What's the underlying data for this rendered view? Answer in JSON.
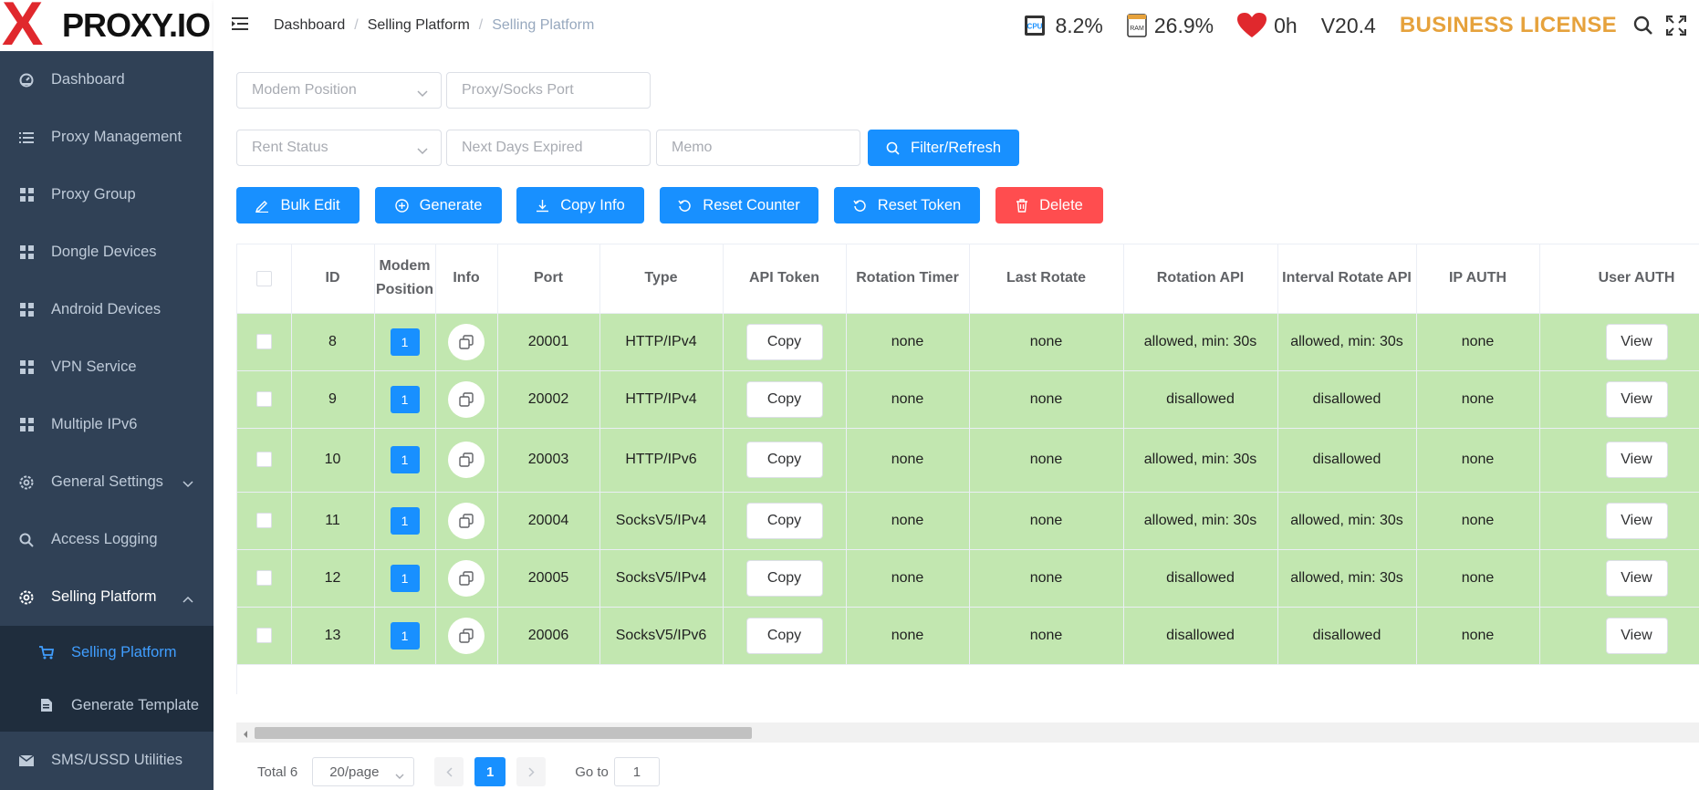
{
  "logo": {
    "x": "X",
    "text": "PROXY.IO"
  },
  "sidebar": {
    "items": [
      {
        "label": "Dashboard",
        "icon": "dashboard-icon"
      },
      {
        "label": "Proxy Management",
        "icon": "list-icon"
      },
      {
        "label": "Proxy Group",
        "icon": "grid-icon"
      },
      {
        "label": "Dongle Devices",
        "icon": "grid-icon"
      },
      {
        "label": "Android Devices",
        "icon": "grid-icon"
      },
      {
        "label": "VPN Service",
        "icon": "grid-icon"
      },
      {
        "label": "Multiple IPv6",
        "icon": "grid-icon"
      },
      {
        "label": "General Settings",
        "icon": "gear-icon"
      },
      {
        "label": "Access Logging",
        "icon": "search-icon"
      },
      {
        "label": "Selling Platform",
        "icon": "gear-icon"
      }
    ],
    "sub_items": [
      {
        "label": "Selling Platform",
        "icon": "cart-icon"
      },
      {
        "label": "Generate Template",
        "icon": "document-icon"
      }
    ],
    "bottom_item": {
      "label": "SMS/USSD Utilities",
      "icon": "mail-icon"
    }
  },
  "header": {
    "breadcrumb": [
      "Dashboard",
      "Selling Platform",
      "Selling Platform"
    ],
    "separator": "/",
    "cpu": "8.2%",
    "ram": "26.9%",
    "uptime": "0h",
    "version": "V20.4",
    "license": "BUSINESS LICENSE",
    "cpu_label": "CPU",
    "ram_label": "RAM"
  },
  "filters": {
    "modem_position": "Modem Position",
    "proxy_port": "Proxy/Socks Port",
    "rent_status": "Rent Status",
    "next_days": "Next Days Expired",
    "memo": "Memo",
    "filter_button": "Filter/Refresh"
  },
  "actions": {
    "bulk_edit": "Bulk Edit",
    "generate": "Generate",
    "copy_info": "Copy Info",
    "reset_counter": "Reset Counter",
    "reset_token": "Reset Token",
    "delete": "Delete"
  },
  "table": {
    "headers": [
      "ID",
      "Modem Position",
      "Info",
      "Port",
      "Type",
      "API Token",
      "Rotation Timer",
      "Last Rotate",
      "Rotation API",
      "Interval Rotate API",
      "IP AUTH",
      "User AUTH"
    ],
    "copy_label": "Copy",
    "view_label": "View",
    "rows": [
      {
        "id": "8",
        "modem": "1",
        "port": "20001",
        "type": "HTTP/IPv4",
        "timer": "none",
        "last": "none",
        "rot_api": "allowed, min: 30s",
        "interval_api": "allowed, min: 30s",
        "ip_auth": "none"
      },
      {
        "id": "9",
        "modem": "1",
        "port": "20002",
        "type": "HTTP/IPv4",
        "timer": "none",
        "last": "none",
        "rot_api": "disallowed",
        "interval_api": "disallowed",
        "ip_auth": "none"
      },
      {
        "id": "10",
        "modem": "1",
        "port": "20003",
        "type": "HTTP/IPv6",
        "timer": "none",
        "last": "none",
        "rot_api": "allowed, min: 30s",
        "interval_api": "disallowed",
        "ip_auth": "none"
      },
      {
        "id": "11",
        "modem": "1",
        "port": "20004",
        "type": "SocksV5/IPv4",
        "timer": "none",
        "last": "none",
        "rot_api": "allowed, min: 30s",
        "interval_api": "allowed, min: 30s",
        "ip_auth": "none"
      },
      {
        "id": "12",
        "modem": "1",
        "port": "20005",
        "type": "SocksV5/IPv4",
        "timer": "none",
        "last": "none",
        "rot_api": "disallowed",
        "interval_api": "allowed, min: 30s",
        "ip_auth": "none"
      },
      {
        "id": "13",
        "modem": "1",
        "port": "20006",
        "type": "SocksV5/IPv6",
        "timer": "none",
        "last": "none",
        "rot_api": "disallowed",
        "interval_api": "disallowed",
        "ip_auth": "none"
      }
    ]
  },
  "pagination": {
    "total": "Total 6",
    "page_size": "20/page",
    "current_page": "1",
    "goto_label": "Go to",
    "goto_value": "1"
  },
  "colors": {
    "sidebar_bg": "#304156",
    "primary": "#1890ff",
    "danger": "#ff4d4f",
    "row_bg": "#c2e7b0",
    "license": "#e6a23c",
    "logo_red": "#e0282d"
  }
}
